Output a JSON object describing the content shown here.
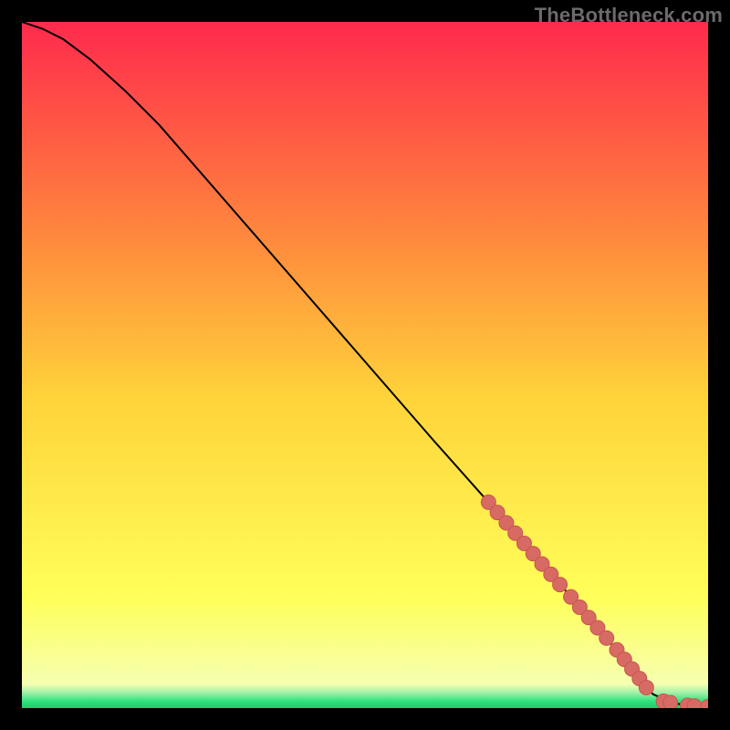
{
  "watermark": "TheBottleneck.com",
  "colors": {
    "background": "#000000",
    "gradient_top": "#ff2a4d",
    "gradient_mid_upper": "#ff7e3e",
    "gradient_mid": "#ffd43a",
    "gradient_mid_lower": "#ffff5a",
    "gradient_thin_green": "#2ee37a",
    "line": "#000000",
    "marker_fill": "#d86a64",
    "marker_stroke": "#c55650"
  },
  "chart_data": {
    "type": "line",
    "title": "",
    "xlabel": "",
    "ylabel": "",
    "xlim": [
      0,
      100
    ],
    "ylim": [
      0,
      100
    ],
    "series": [
      {
        "name": "curve",
        "x": [
          0,
          3,
          6,
          10,
          15,
          20,
          30,
          40,
          50,
          60,
          68,
          85,
          90,
          92,
          95,
          98,
          100
        ],
        "y": [
          100,
          99,
          97.5,
          94.5,
          90,
          85,
          73.5,
          62,
          50.5,
          39,
          30,
          10.5,
          4,
          2,
          0.7,
          0.3,
          0.2
        ]
      }
    ],
    "markers": [
      {
        "x": 68,
        "y": 30
      },
      {
        "x": 69.3,
        "y": 28.5
      },
      {
        "x": 70.6,
        "y": 27
      },
      {
        "x": 71.9,
        "y": 25.5
      },
      {
        "x": 73.2,
        "y": 24
      },
      {
        "x": 74.5,
        "y": 22.5
      },
      {
        "x": 75.8,
        "y": 21
      },
      {
        "x": 77.1,
        "y": 19.5
      },
      {
        "x": 78.4,
        "y": 18
      },
      {
        "x": 80.0,
        "y": 16.2
      },
      {
        "x": 81.3,
        "y": 14.7
      },
      {
        "x": 82.6,
        "y": 13.2
      },
      {
        "x": 83.9,
        "y": 11.7
      },
      {
        "x": 85.2,
        "y": 10.2
      },
      {
        "x": 86.7,
        "y": 8.5
      },
      {
        "x": 87.8,
        "y": 7.1
      },
      {
        "x": 88.9,
        "y": 5.7
      },
      {
        "x": 90.0,
        "y": 4.3
      },
      {
        "x": 91.0,
        "y": 3.0
      },
      {
        "x": 93.5,
        "y": 1.0
      },
      {
        "x": 94.5,
        "y": 0.8
      },
      {
        "x": 97.0,
        "y": 0.4
      },
      {
        "x": 98.0,
        "y": 0.3
      },
      {
        "x": 100.0,
        "y": 0.2
      }
    ]
  }
}
